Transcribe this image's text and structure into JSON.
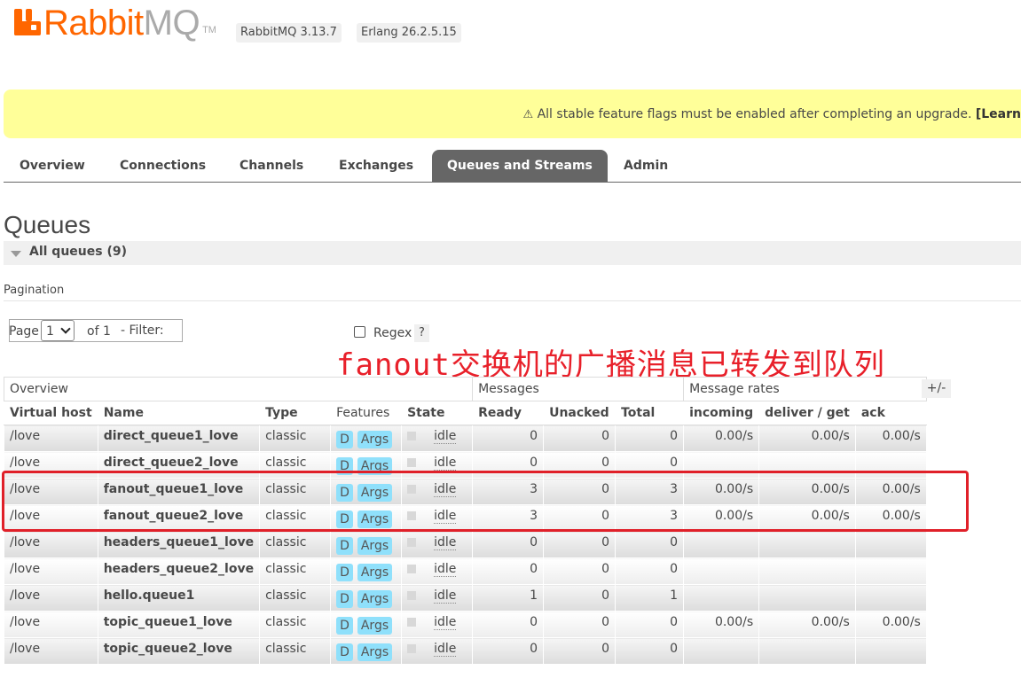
{
  "header": {
    "logo_text_orange": "Rabbit",
    "logo_text_gray": "MQ",
    "logo_tm": "TM",
    "version_rabbitmq": "RabbitMQ 3.13.7",
    "version_erlang": "Erlang 26.2.5.15"
  },
  "banner": {
    "warning_icon": "⚠",
    "text": "All stable feature flags must be enabled after completing an upgrade.",
    "link": "[Learn"
  },
  "tabs": [
    {
      "label": "Overview",
      "active": false
    },
    {
      "label": "Connections",
      "active": false
    },
    {
      "label": "Channels",
      "active": false
    },
    {
      "label": "Exchanges",
      "active": false
    },
    {
      "label": "Queues and Streams",
      "active": true
    },
    {
      "label": "Admin",
      "active": false
    }
  ],
  "page": {
    "title": "Queues",
    "section_title": "All queues (9)"
  },
  "pagination": {
    "label": "Pagination",
    "page_label": "Page",
    "page_value": "1",
    "of_label": "of 1",
    "filter_label": "- Filter:",
    "filter_value": "",
    "regex_label": "Regex",
    "help_label": "?"
  },
  "annotation": "fanout交换机的广播消息已转发到队列",
  "table": {
    "groups": {
      "overview": "Overview",
      "messages": "Messages",
      "rates": "Message rates"
    },
    "plus_minus": "+/-",
    "columns": {
      "vhost": "Virtual host",
      "name": "Name",
      "type": "Type",
      "features": "Features",
      "state": "State",
      "ready": "Ready",
      "unacked": "Unacked",
      "total": "Total",
      "incoming": "incoming",
      "deliver": "deliver / get",
      "ack": "ack"
    },
    "rows": [
      {
        "vhost": "/love",
        "name": "direct_queue1_love",
        "type": "classic",
        "f1": "D",
        "f2": "Args",
        "state": "idle",
        "ready": "0",
        "unacked": "0",
        "total": "0",
        "incoming": "0.00/s",
        "deliver": "0.00/s",
        "ack": "0.00/s"
      },
      {
        "vhost": "/love",
        "name": "direct_queue2_love",
        "type": "classic",
        "f1": "D",
        "f2": "Args",
        "state": "idle",
        "ready": "0",
        "unacked": "0",
        "total": "0",
        "incoming": "",
        "deliver": "",
        "ack": ""
      },
      {
        "vhost": "/love",
        "name": "fanout_queue1_love",
        "type": "classic",
        "f1": "D",
        "f2": "Args",
        "state": "idle",
        "ready": "3",
        "unacked": "0",
        "total": "3",
        "incoming": "0.00/s",
        "deliver": "0.00/s",
        "ack": "0.00/s"
      },
      {
        "vhost": "/love",
        "name": "fanout_queue2_love",
        "type": "classic",
        "f1": "D",
        "f2": "Args",
        "state": "idle",
        "ready": "3",
        "unacked": "0",
        "total": "3",
        "incoming": "0.00/s",
        "deliver": "0.00/s",
        "ack": "0.00/s"
      },
      {
        "vhost": "/love",
        "name": "headers_queue1_love",
        "type": "classic",
        "f1": "D",
        "f2": "Args",
        "state": "idle",
        "ready": "0",
        "unacked": "0",
        "total": "0",
        "incoming": "",
        "deliver": "",
        "ack": ""
      },
      {
        "vhost": "/love",
        "name": "headers_queue2_love",
        "type": "classic",
        "f1": "D",
        "f2": "Args",
        "state": "idle",
        "ready": "0",
        "unacked": "0",
        "total": "0",
        "incoming": "",
        "deliver": "",
        "ack": ""
      },
      {
        "vhost": "/love",
        "name": "hello.queue1",
        "type": "classic",
        "f1": "D",
        "f2": "Args",
        "state": "idle",
        "ready": "1",
        "unacked": "0",
        "total": "1",
        "incoming": "",
        "deliver": "",
        "ack": ""
      },
      {
        "vhost": "/love",
        "name": "topic_queue1_love",
        "type": "classic",
        "f1": "D",
        "f2": "Args",
        "state": "idle",
        "ready": "0",
        "unacked": "0",
        "total": "0",
        "incoming": "0.00/s",
        "deliver": "0.00/s",
        "ack": "0.00/s"
      },
      {
        "vhost": "/love",
        "name": "topic_queue2_love",
        "type": "classic",
        "f1": "D",
        "f2": "Args",
        "state": "idle",
        "ready": "0",
        "unacked": "0",
        "total": "0",
        "incoming": "",
        "deliver": "",
        "ack": ""
      }
    ]
  },
  "colors": {
    "brand_orange": "#ff6600",
    "banner_yellow": "#ffff99",
    "active_tab": "#666666",
    "feature_badge": "#8fe0fb",
    "annotation_red": "#e8202a"
  }
}
